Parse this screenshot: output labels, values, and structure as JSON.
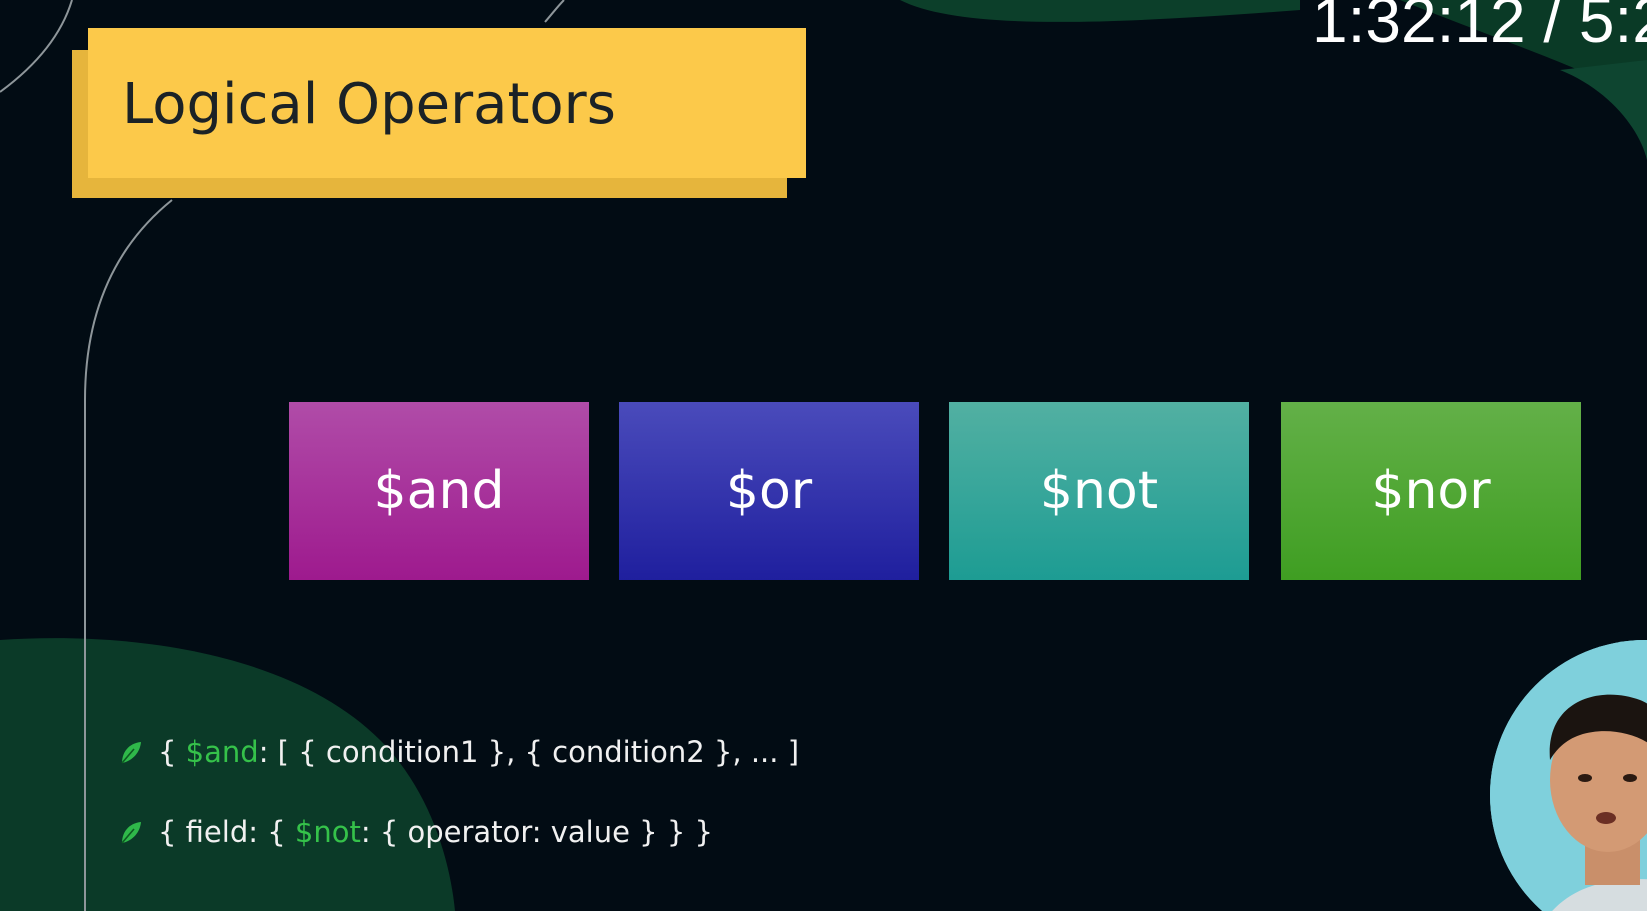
{
  "player": {
    "timestamp": "1:32:12 / 5:2"
  },
  "slide": {
    "title": "Logical Operators",
    "operators": [
      {
        "label": "$and",
        "color": "#a0228f"
      },
      {
        "label": "$or",
        "color": "#24229f"
      },
      {
        "label": "$not",
        "color": "#24a096"
      },
      {
        "label": "$nor",
        "color": "#42a024"
      }
    ],
    "bullets": [
      {
        "prefix": "{ ",
        "keyword": "$and",
        "suffix": ": [ { condition1 }, { condition2 }, ... ]"
      },
      {
        "prefix": "{ field: { ",
        "keyword": "$not",
        "suffix": ": { operator: value } } }"
      }
    ],
    "accent_color": "#35c24a",
    "title_bg_color": "#fcc94a"
  },
  "icons": {
    "bullet": "leaf-icon"
  }
}
